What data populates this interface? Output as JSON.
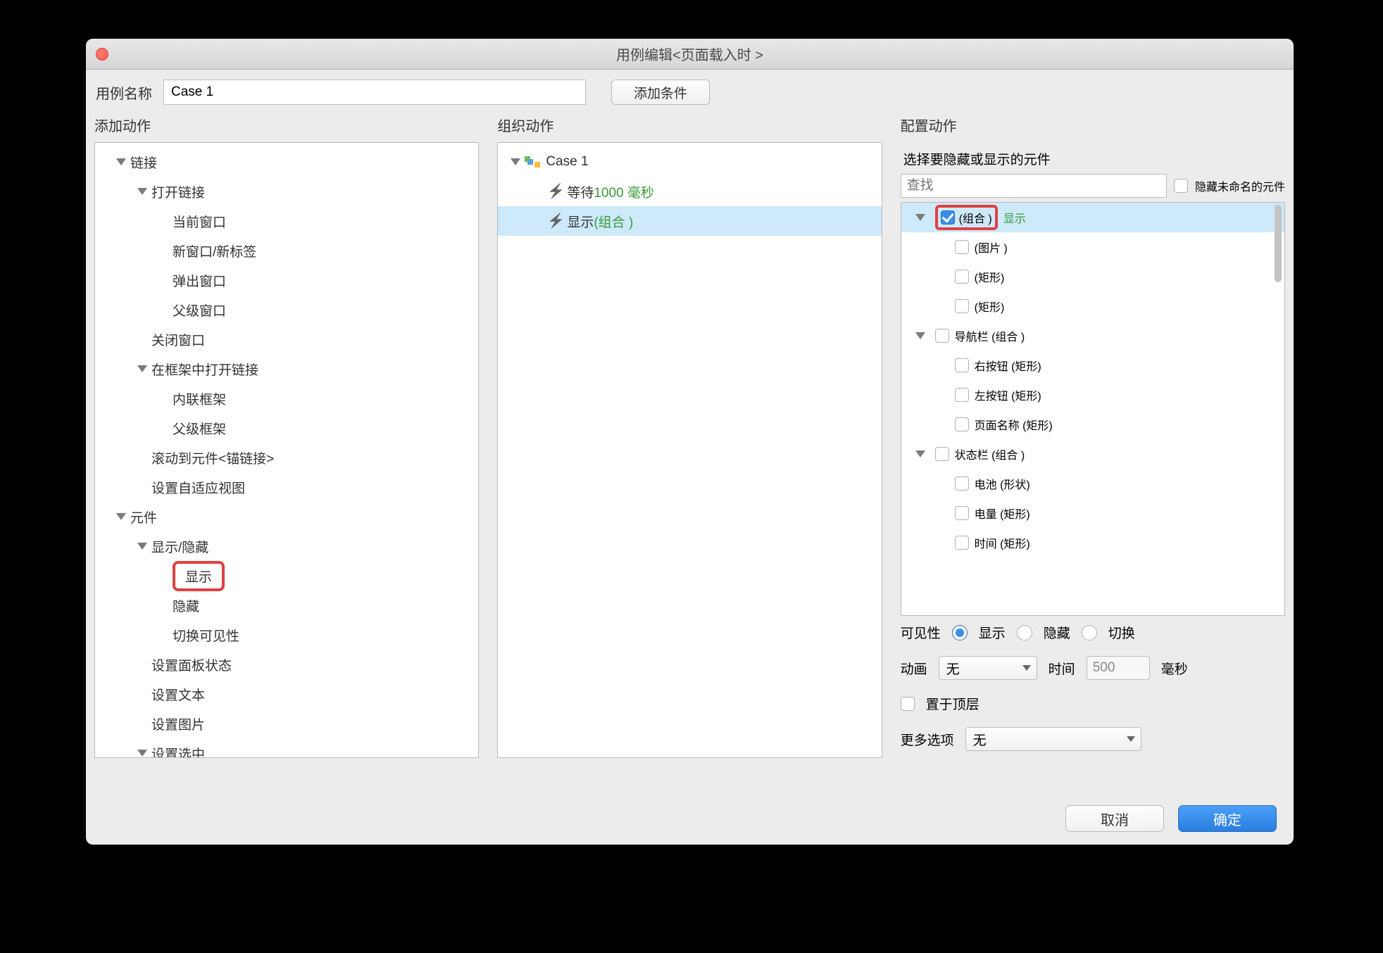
{
  "window_title": "用例编辑<页面载入时 >",
  "top": {
    "case_name_label": "用例名称",
    "case_name_value": "Case 1",
    "add_condition_label": "添加条件"
  },
  "cols": {
    "add_action": "添加动作",
    "organize_action": "组织动作",
    "configure_action": "配置动作"
  },
  "action_tree": {
    "link": "链接",
    "open_link": "打开链接",
    "current_window": "当前窗口",
    "new_window_tab": "新窗口/新标签",
    "popup_window": "弹出窗口",
    "parent_window": "父级窗口",
    "close_window": "关闭窗口",
    "open_in_frame": "在框架中打开链接",
    "inline_frame": "内联框架",
    "parent_frame": "父级框架",
    "scroll_to_anchor": "滚动到元件<锚链接>",
    "set_adaptive": "设置自适应视图",
    "widgets": "元件",
    "show_hide": "显示/隐藏",
    "show": "显示",
    "hide": "隐藏",
    "toggle_visibility": "切换可见性",
    "set_panel_state": "设置面板状态",
    "set_text": "设置文本",
    "set_image": "设置图片",
    "set_selected": "设置选中"
  },
  "organize": {
    "case_label": "Case 1",
    "wait_prefix": "等待 ",
    "wait_value": "1000 毫秒",
    "show_prefix": "显示 ",
    "show_target": "(组合 )"
  },
  "configure": {
    "select_widgets_label": "选择要隐藏或显示的元件",
    "search_placeholder": "查找",
    "hide_unnamed_label": "隐藏未命名的元件",
    "items": {
      "group": "(组合 )",
      "group_state": "显示",
      "image": "(图片 )",
      "rect1": "(矩形)",
      "rect2": "(矩形)",
      "navbar": "导航栏 (组合 )",
      "right_btn": "右按钮 (矩形)",
      "left_btn": "左按钮 (矩形)",
      "page_name": "页面名称 (矩形)",
      "statusbar": "状态栏 (组合 )",
      "battery": "电池 (形状)",
      "power": "电量 (矩形)",
      "time": "时间 (矩形)"
    },
    "visibility_label": "可见性",
    "radio_show": "显示",
    "radio_hide": "隐藏",
    "radio_toggle": "切换",
    "animation_label": "动画",
    "animation_value": "无",
    "time_label": "时间",
    "time_value": "500",
    "time_unit": "毫秒",
    "bring_front_label": "置于顶层",
    "more_options_label": "更多选项",
    "more_options_value": "无"
  },
  "footer": {
    "cancel": "取消",
    "ok": "确定"
  }
}
